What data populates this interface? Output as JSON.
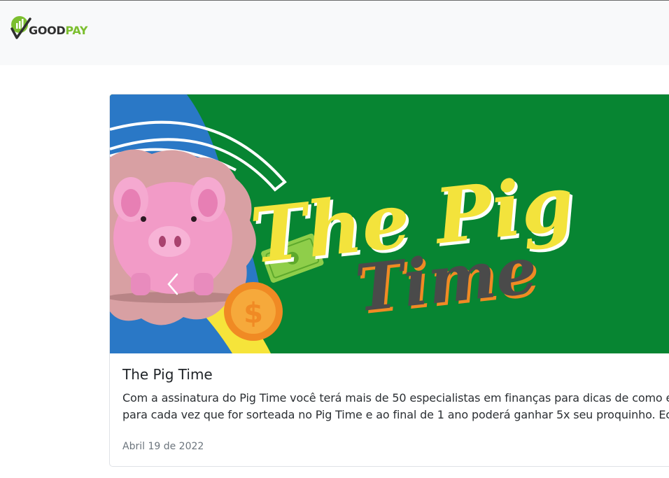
{
  "navbar": {
    "brand_part1": "GOOD",
    "brand_part2": "PAY",
    "logo_icon": "check-growth-icon",
    "colors": {
      "background": "#f8f9fa",
      "brand_green": "#7cbf2f",
      "brand_dark": "#2f2f2f"
    }
  },
  "post": {
    "image": {
      "title_line1": "The Pig",
      "title_line2": "Time",
      "coin_symbol": "$",
      "colors": {
        "background": "#078532",
        "title_yellow": "#f3e33c",
        "title_dark": "#4a4a4a",
        "pig_pink": "#f29bc7",
        "coin_orange": "#f08a24"
      }
    },
    "carousel_prev_icon": "chevron-left-icon",
    "title": "The Pig Time",
    "text_line1": "Com a assinatura do Pig Time você terá mais de 50 especialistas em finanças para dicas de como econo",
    "text_line2": "para cada vez que for sorteada no Pig Time e ao final de 1 ano poderá ganhar 5x seu proquinho. Ecomiz",
    "date": "Abril 19 de 2022"
  }
}
